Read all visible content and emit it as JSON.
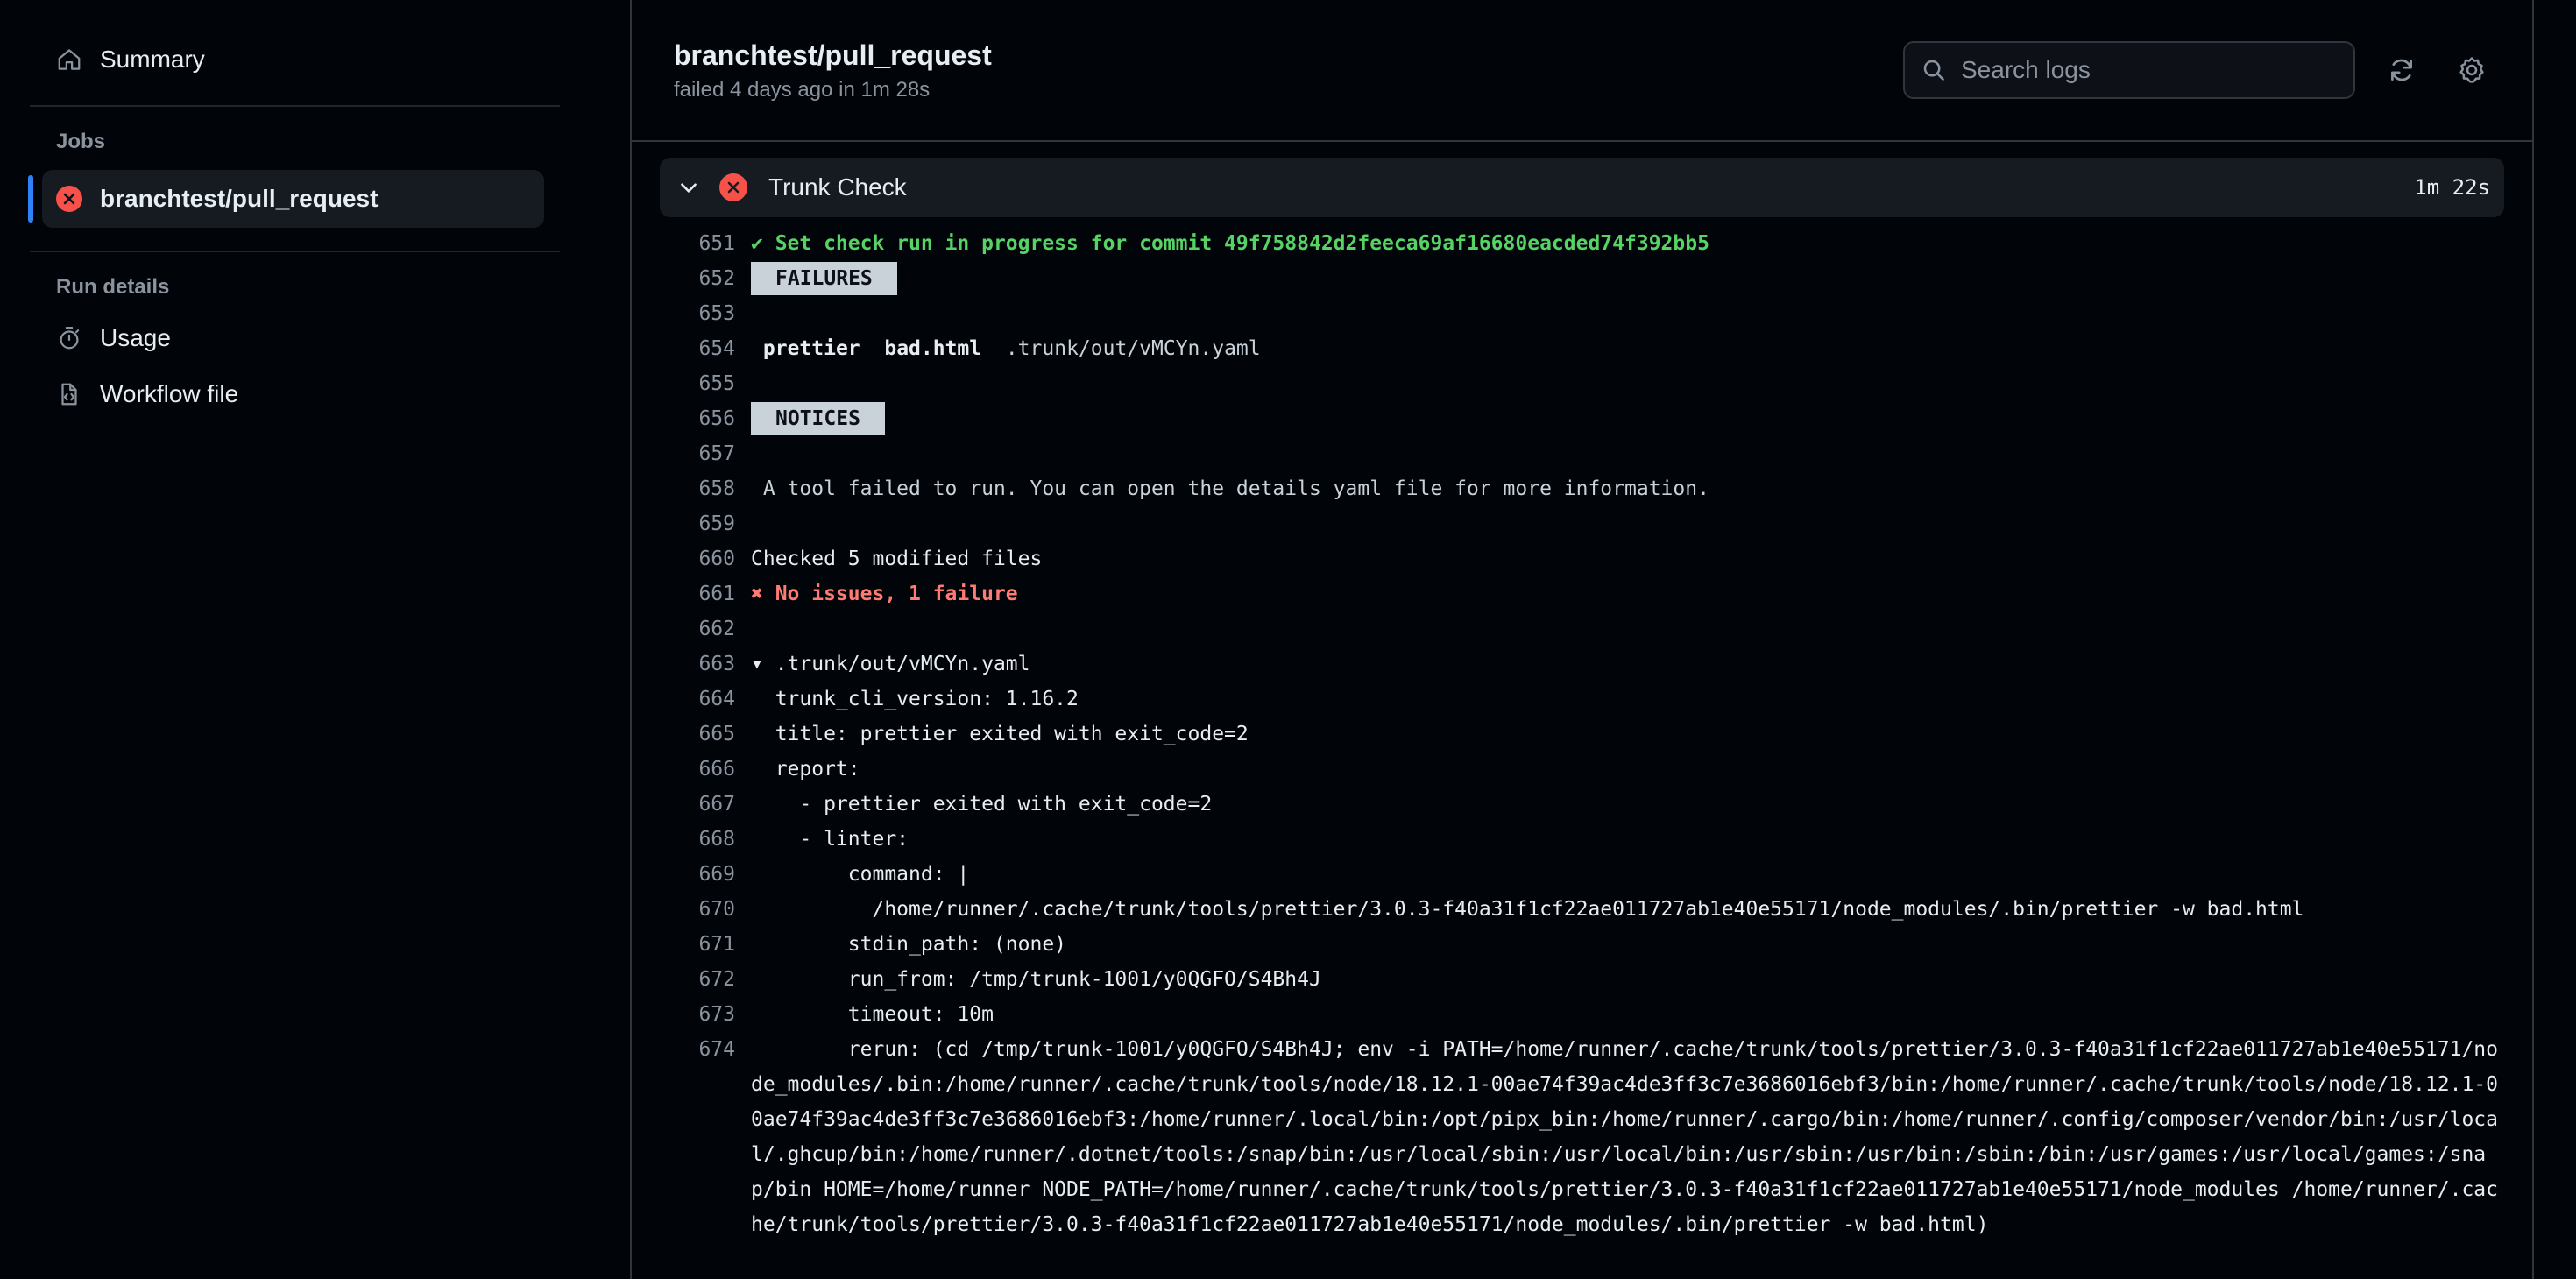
{
  "sidebar": {
    "summary_label": "Summary",
    "jobs_heading": "Jobs",
    "job_label": "branchtest/pull_request",
    "run_details_heading": "Run details",
    "usage_label": "Usage",
    "workflow_label": "Workflow file"
  },
  "header": {
    "title": "branchtest/pull_request",
    "subtitle": "failed 4 days ago in 1m 28s",
    "search_placeholder": "Search logs"
  },
  "step": {
    "name": "Trunk Check",
    "duration": "1m 22s"
  },
  "log": {
    "l651": {
      "num": "651",
      "text": "✔ Set check run in progress for commit 49f758842d2feeca69af16680eacded74f392bb5"
    },
    "l652": {
      "num": "652",
      "text": "FAILURES"
    },
    "l653": {
      "num": "653"
    },
    "l654": {
      "num": "654",
      "linter": "prettier",
      "file": "bad.html",
      "detail": ".trunk/out/vMCYn.yaml"
    },
    "l655": {
      "num": "655"
    },
    "l656": {
      "num": "656",
      "text": "NOTICES"
    },
    "l657": {
      "num": "657"
    },
    "l658": {
      "num": "658",
      "text": " A tool failed to run. You can open the details yaml file for more information."
    },
    "l659": {
      "num": "659"
    },
    "l660": {
      "num": "660",
      "text": "Checked 5 modified files"
    },
    "l661": {
      "num": "661",
      "text": "✖ No issues, 1 failure"
    },
    "l662": {
      "num": "662"
    },
    "l663": {
      "num": "663",
      "text": "▾ .trunk/out/vMCYn.yaml"
    },
    "l664": {
      "num": "664",
      "text": "  trunk_cli_version: 1.16.2"
    },
    "l665": {
      "num": "665",
      "text": "  title: prettier exited with exit_code=2"
    },
    "l666": {
      "num": "666",
      "text": "  report:"
    },
    "l667": {
      "num": "667",
      "text": "    - prettier exited with exit_code=2"
    },
    "l668": {
      "num": "668",
      "text": "    - linter:"
    },
    "l669": {
      "num": "669",
      "text": "        command: |"
    },
    "l670": {
      "num": "670",
      "text": "          /home/runner/.cache/trunk/tools/prettier/3.0.3-f40a31f1cf22ae011727ab1e40e55171/node_modules/.bin/prettier -w bad.html"
    },
    "l671": {
      "num": "671",
      "text": "        stdin_path: (none)"
    },
    "l672": {
      "num": "672",
      "text": "        run_from: /tmp/trunk-1001/y0QGFO/S4Bh4J"
    },
    "l673": {
      "num": "673",
      "text": "        timeout: 10m"
    },
    "l674": {
      "num": "674",
      "text": "        rerun: (cd /tmp/trunk-1001/y0QGFO/S4Bh4J; env -i PATH=/home/runner/.cache/trunk/tools/prettier/3.0.3-f40a31f1cf22ae011727ab1e40e55171/node_modules/.bin:/home/runner/.cache/trunk/tools/node/18.12.1-00ae74f39ac4de3ff3c7e3686016ebf3/bin:/home/runner/.cache/trunk/tools/node/18.12.1-00ae74f39ac4de3ff3c7e3686016ebf3:/home/runner/.local/bin:/opt/pipx_bin:/home/runner/.cargo/bin:/home/runner/.config/composer/vendor/bin:/usr/local/.ghcup/bin:/home/runner/.dotnet/tools:/snap/bin:/usr/local/sbin:/usr/local/bin:/usr/sbin:/usr/bin:/sbin:/bin:/usr/games:/usr/local/games:/snap/bin HOME=/home/runner NODE_PATH=/home/runner/.cache/trunk/tools/prettier/3.0.3-f40a31f1cf22ae011727ab1e40e55171/node_modules /home/runner/.cache/trunk/tools/prettier/3.0.3-f40a31f1cf22ae011727ab1e40e55171/node_modules/.bin/prettier -w bad.html)"
    }
  }
}
